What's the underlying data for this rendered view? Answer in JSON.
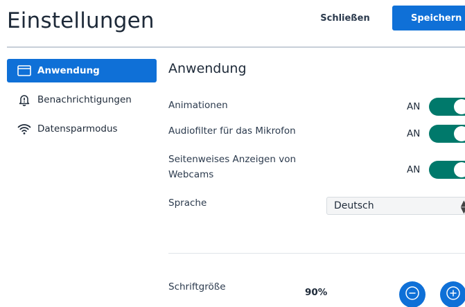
{
  "header": {
    "title": "Einstellungen",
    "close_label": "Schließen",
    "save_label": "Speichern"
  },
  "sidebar": {
    "items": [
      {
        "label": "Anwendung",
        "icon": "window-icon",
        "active": true
      },
      {
        "label": "Benachrichtigungen",
        "icon": "bell-alert-icon",
        "active": false
      },
      {
        "label": "Datensparmodus",
        "icon": "wifi-icon",
        "active": false
      }
    ]
  },
  "main": {
    "section_title": "Anwendung",
    "settings": [
      {
        "label": "Animationen",
        "state_text": "AN",
        "enabled": true
      },
      {
        "label": "Audiofilter für das Mikrofon",
        "state_text": "AN",
        "enabled": true
      },
      {
        "label": "Seitenweises Anzeigen von Webcams",
        "state_text": "AN",
        "enabled": true
      }
    ],
    "language": {
      "label": "Sprache",
      "selected": "Deutsch"
    },
    "font_size": {
      "label": "Schriftgröße",
      "value": "90%",
      "decrease_icon": "minus-circle-icon",
      "increase_icon": "plus-circle-icon"
    }
  },
  "colors": {
    "primary": "#0f70d7",
    "toggle_on": "#00796b",
    "divider": "#c7cfd8"
  }
}
